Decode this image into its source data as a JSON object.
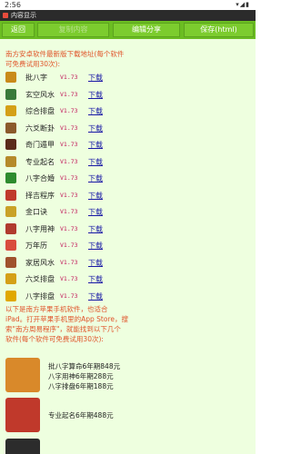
{
  "status_bar": {
    "time": "2:56"
  },
  "title_bar": {
    "title": "内容显示"
  },
  "toolbar": {
    "back_label": "返回",
    "copy_label": "复制内容",
    "edit_share_label": "编辑分享",
    "save_label": "保存(html)"
  },
  "android_section": {
    "heading_line1": "南方安卓软件最新版下载地址(每个软件",
    "heading_line2": "可免费试用30次):",
    "items": [
      {
        "name": "批八字",
        "version": "V1.73",
        "link": "下载",
        "icon": "eight-char-icon",
        "color": "#c98a1a"
      },
      {
        "name": "玄空风水",
        "version": "V1.73",
        "link": "下载",
        "icon": "feng-shui-compass-icon",
        "color": "#3a7a3a"
      },
      {
        "name": "综合排盘",
        "version": "V1.73",
        "link": "下载",
        "icon": "chart-layout-icon",
        "color": "#d4a017"
      },
      {
        "name": "六爻断卦",
        "version": "V1.73",
        "link": "下载",
        "icon": "hexagram-icon",
        "color": "#8b5a2b"
      },
      {
        "name": "奇门遁甲",
        "version": "V1.73",
        "link": "下载",
        "icon": "qimen-icon",
        "color": "#5a2a1a"
      },
      {
        "name": "专业起名",
        "version": "V1.73",
        "link": "下载",
        "icon": "naming-icon",
        "color": "#b58a2a"
      },
      {
        "name": "八字合婚",
        "version": "V1.73",
        "link": "下载",
        "icon": "marriage-icon",
        "color": "#2e8b2e"
      },
      {
        "name": "择吉程序",
        "version": "V1.73",
        "link": "下载",
        "icon": "auspicious-date-icon",
        "color": "#c0392b"
      },
      {
        "name": "金口诀",
        "version": "V1.73",
        "link": "下载",
        "icon": "golden-mouth-icon",
        "color": "#c9a227"
      },
      {
        "name": "八字用神",
        "version": "V1.73",
        "link": "下载",
        "icon": "useful-god-icon",
        "color": "#b03a2e"
      },
      {
        "name": "万年历",
        "version": "V1.73",
        "link": "下载",
        "icon": "calendar-icon",
        "color": "#d94c3d"
      },
      {
        "name": "家居风水",
        "version": "V1.73",
        "link": "下载",
        "icon": "home-feng-shui-icon",
        "color": "#a0522d"
      },
      {
        "name": "六爻排盘",
        "version": "V1.73",
        "link": "下载",
        "icon": "liuyao-chart-icon",
        "color": "#d4a017"
      },
      {
        "name": "八字排盘",
        "version": "V1.73",
        "link": "下载",
        "icon": "bazi-chart-icon",
        "color": "#e0a800"
      }
    ]
  },
  "ios_section": {
    "heading_line1": "以下是南方苹果手机软件，也适合",
    "heading_line2": "iPad。打开苹果手机里的App Store，搜",
    "heading_line3": "索\"南方周易程序\"，就能找到以下几个",
    "heading_line4": "软件(每个软件可免费试用30次):",
    "promo1": {
      "lines": [
        "批八字算命6年期848元",
        "八字用神6年期288元",
        "八字排盘6年期188元"
      ],
      "color": "#d9892a"
    },
    "promo2": {
      "lines": [
        "专业起名6年期488元"
      ],
      "color": "#c0392b"
    }
  }
}
